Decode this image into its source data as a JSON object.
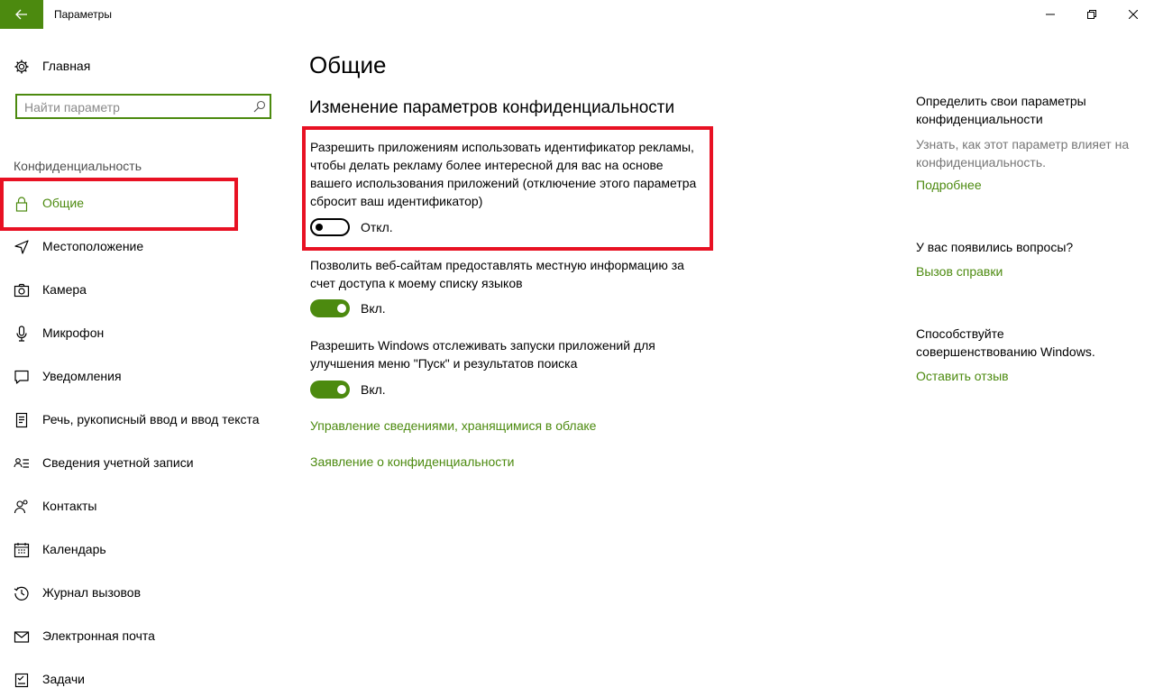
{
  "titlebar": {
    "title": "Параметры",
    "back_icon": "back-arrow-icon",
    "accent": "#4c8a0f"
  },
  "sidebar": {
    "home_label": "Главная",
    "search": {
      "placeholder": "Найти параметр",
      "value": ""
    },
    "section_label": "Конфиденциальность",
    "items": [
      {
        "label": "Общие",
        "icon": "lock-icon",
        "selected": true
      },
      {
        "label": "Местоположение",
        "icon": "location-icon"
      },
      {
        "label": "Камера",
        "icon": "camera-icon"
      },
      {
        "label": "Микрофон",
        "icon": "microphone-icon"
      },
      {
        "label": "Уведомления",
        "icon": "notifications-icon"
      },
      {
        "label": "Речь, рукописный ввод и ввод текста",
        "icon": "speech-icon"
      },
      {
        "label": "Сведения учетной записи",
        "icon": "account-info-icon"
      },
      {
        "label": "Контакты",
        "icon": "contacts-icon"
      },
      {
        "label": "Календарь",
        "icon": "calendar-icon"
      },
      {
        "label": "Журнал вызовов",
        "icon": "call-history-icon"
      },
      {
        "label": "Электронная почта",
        "icon": "mail-icon"
      },
      {
        "label": "Задачи",
        "icon": "tasks-icon"
      }
    ]
  },
  "main": {
    "title": "Общие",
    "subtitle": "Изменение параметров конфиденциальности",
    "settings": [
      {
        "text": "Разрешить приложениям использовать идентификатор рекламы, чтобы делать рекламу более интересной для вас на основе вашего использования приложений (отключение этого параметра сбросит ваш идентификатор)",
        "state_label": "Откл.",
        "on": false
      },
      {
        "text": "Позволить веб-сайтам предоставлять местную информацию за счет доступа к моему списку языков",
        "state_label": "Вкл.",
        "on": true
      },
      {
        "text": "Разрешить Windows отслеживать запуски приложений для улучшения меню \"Пуск\" и результатов поиска",
        "state_label": "Вкл.",
        "on": true
      }
    ],
    "links": [
      "Управление сведениями, хранящимися в облаке",
      "Заявление о конфиденциальности"
    ]
  },
  "rail": {
    "block1_heading": "Определить свои параметры конфиденциальности",
    "block1_text": "Узнать, как этот параметр влияет на конфиденциальность.",
    "block1_link": "Подробнее",
    "block2_heading": "У вас появились вопросы?",
    "block2_link": "Вызов справки",
    "block3_heading": "Способствуйте совершенствованию Windows.",
    "block3_link": "Оставить отзыв"
  },
  "highlight_color": "#e81123"
}
